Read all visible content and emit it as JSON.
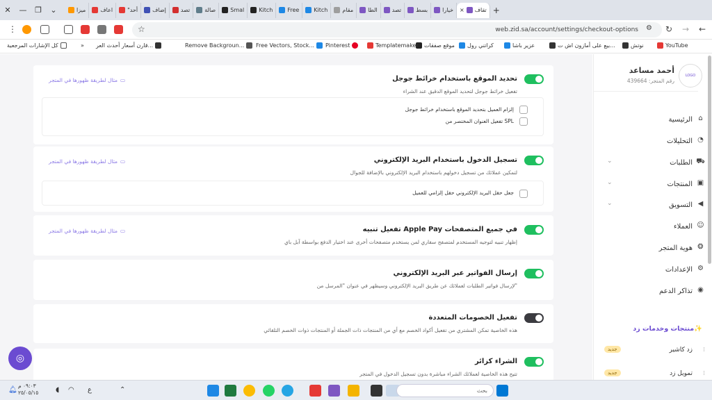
{
  "browser": {
    "tabs": [
      "تقاف",
      "×",
      "تنظيم",
      "فالتو",
      "خيارا",
      "ستجلب",
      "بسط",
      "تصد",
      "الطا",
      "مقام",
      "Kitch",
      "Free",
      "Kitch",
      "Smal",
      "صالة",
      "تصد",
      "إضاف",
      "\"أحد",
      "اعاف",
      "ميزا"
    ],
    "url": "web.zid.sa/account/settings/checkout-options",
    "bookmarks": [
      "YouTube",
      "نوتش",
      "بيع على أمازون اش ت...",
      "عزير باشا",
      "كراتني رول",
      "موقع صفقات",
      "Templatemaker",
      "Pinterest",
      "Free Vectors, Stock...",
      "Remove Backgroun...",
      "قارن أسعار أحدث العر...",
      "كل الإشارات المرجعية"
    ]
  },
  "sidebar": {
    "name": "أحمد مساعد",
    "store_number": "رقم المتجر: 439664",
    "nav": [
      {
        "label": "الرئيسية",
        "icon": "home-icon"
      },
      {
        "label": "التحليلات",
        "icon": "analytics-icon"
      },
      {
        "label": "الطلبات",
        "icon": "cart-icon"
      },
      {
        "label": "المنتجات",
        "icon": "box-icon"
      },
      {
        "label": "التسويق",
        "icon": "megaphone-icon"
      },
      {
        "label": "العملاء",
        "icon": "users-icon"
      },
      {
        "label": "هوية المتجر",
        "icon": "palette-icon"
      },
      {
        "label": "الإعدادات",
        "icon": "gear-icon"
      },
      {
        "label": "تذاكر الدعم",
        "icon": "support-icon"
      }
    ],
    "products_heading": "منتجات وخدمات زد✨",
    "products": [
      {
        "label": "زد كاشير",
        "badge": "جديد"
      },
      {
        "label": "تمويل زد",
        "badge": "جديد"
      }
    ]
  },
  "settings": [
    {
      "title": "تحديد الموقع باستخدام خرائط جوجل",
      "desc": "تفعيل خرائط جوجل لتحديد الموقع الدقيق عند الشراء",
      "hint": "مثال لطريقة ظهورها في المتجر",
      "enabled": true,
      "options": [
        "إلزام العميل بتحديد الموقع باستخدام خرائط جوجل",
        "تفعيل العنوان المختصر من SPL"
      ]
    },
    {
      "title": "تسجيل الدخول باستخدام البريد الإلكتروني",
      "desc": "لتمكين عملائك من تسجيل دخولهم باستخدام البريد الإلكتروني بالإضافة للجوال",
      "hint": "مثال لطريقة ظهورها في المتجر",
      "enabled": true,
      "options": [
        "جعل حقل البريد الإلكتروني حقل إلزامي للعميل"
      ]
    },
    {
      "title": "تفعيل تنبيه Apple Pay في جميع المتصفحات",
      "desc": "إظهار تنبيه لتوجيه المستخدم لمتصفح سفاري لمن يستخدم متصفحات أخرى عند اختيار الدفع بواسطة آبل باي",
      "hint": "مثال لطريقة ظهورها في المتجر",
      "enabled": true,
      "options": []
    },
    {
      "title": "إرسال الفواتير عبر البريد الإلكتروني",
      "desc": "لإرسال فواتير الطلبات لعملائك عن طريق البريد الإلكتروني وسيظهر في عنوان \"المرسل من\"",
      "hint": "",
      "enabled": true,
      "options": []
    },
    {
      "title": "تفعيل الخصومات المتعددة",
      "desc": "هذه الخاصية تمكن المشتري من تفعيل أكواد الخصم مع أي من المنتجات ذات الجملة أو المنتجات ذوات الخصم التلقائي",
      "hint": "",
      "enabled": false,
      "options": []
    },
    {
      "title": "الشراء كزائر",
      "desc": "تتيح هذه الخاصية لعملائك الشراء مباشرة بدون تسجيل الدخول في المتجر",
      "hint": "",
      "enabled": true,
      "options": []
    }
  ],
  "taskbar": {
    "search": "بحث",
    "clock_time": "٠٩:٠٣ م",
    "clock_date": "٢٥/٠٥/١٥",
    "lang": "ع"
  }
}
